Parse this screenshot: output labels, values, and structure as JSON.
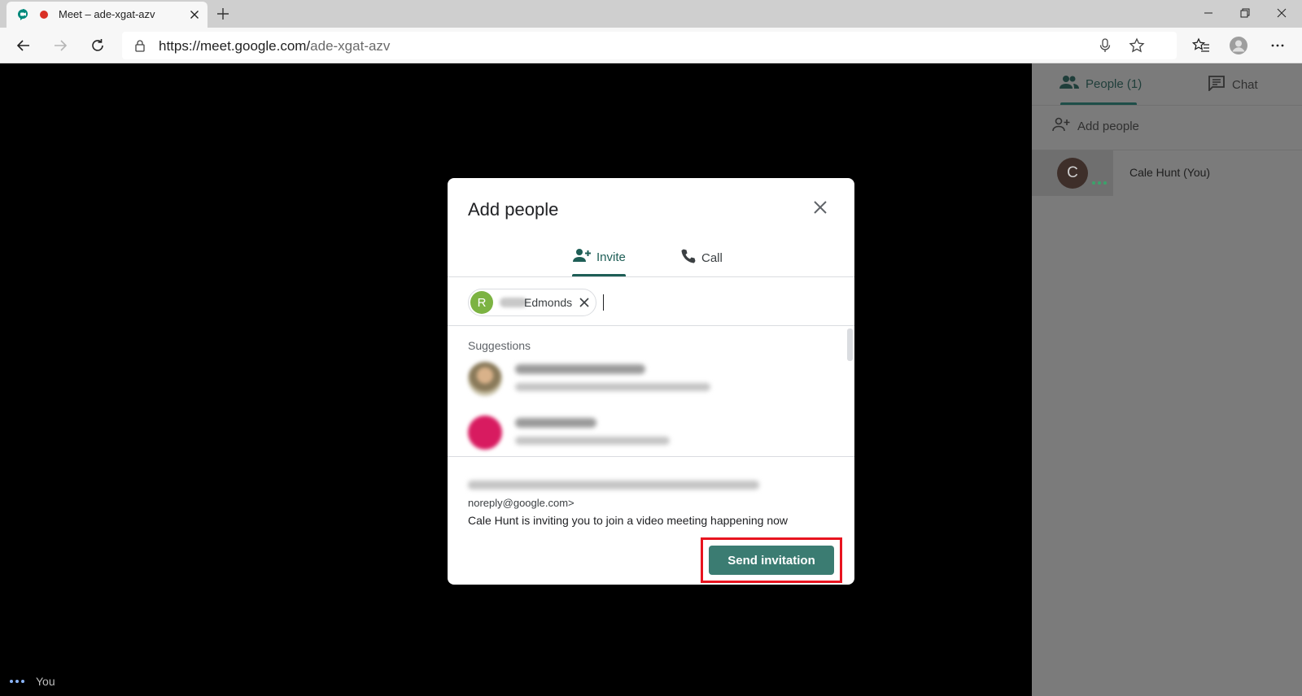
{
  "browser": {
    "tab_title": "Meet – ade-xgat-azv",
    "url_host": "https://meet.google.com/",
    "url_path": "ade-xgat-azv",
    "icons": [
      "meet-favicon",
      "recording-dot",
      "close-icon",
      "plus-icon",
      "minimize-icon",
      "restore-icon",
      "window-close-icon",
      "back-icon",
      "forward-icon",
      "refresh-icon",
      "lock-icon",
      "microphone-icon",
      "star-icon",
      "favorites-icon",
      "profile-icon",
      "more-icon"
    ]
  },
  "video": {
    "self_label": "You"
  },
  "side_panel": {
    "tabs": [
      {
        "label": "People (1)",
        "icon": "people-icon",
        "selected": true
      },
      {
        "label": "Chat",
        "icon": "chat-icon",
        "selected": false
      }
    ],
    "add_people_label": "Add people",
    "participants": [
      {
        "initial": "C",
        "name": "Cale Hunt (You)",
        "avatar_color": "#3e2f2a"
      }
    ]
  },
  "modal": {
    "title": "Add people",
    "tabs": [
      {
        "label": "Invite",
        "icon": "person-add-icon",
        "selected": true
      },
      {
        "label": "Call",
        "icon": "phone-icon",
        "selected": false
      }
    ],
    "recipient_chip": {
      "initial": "R",
      "visible_name": "Edmonds",
      "avatar_color": "#7cb342"
    },
    "suggestions_label": "Suggestions",
    "sender_email": "noreply@google.com>",
    "invite_message": "Cale Hunt is inviting you to join a video meeting happening now",
    "send_button_label": "Send invitation",
    "accent_color": "#3b7c72",
    "highlight_color": "#e8141f"
  }
}
